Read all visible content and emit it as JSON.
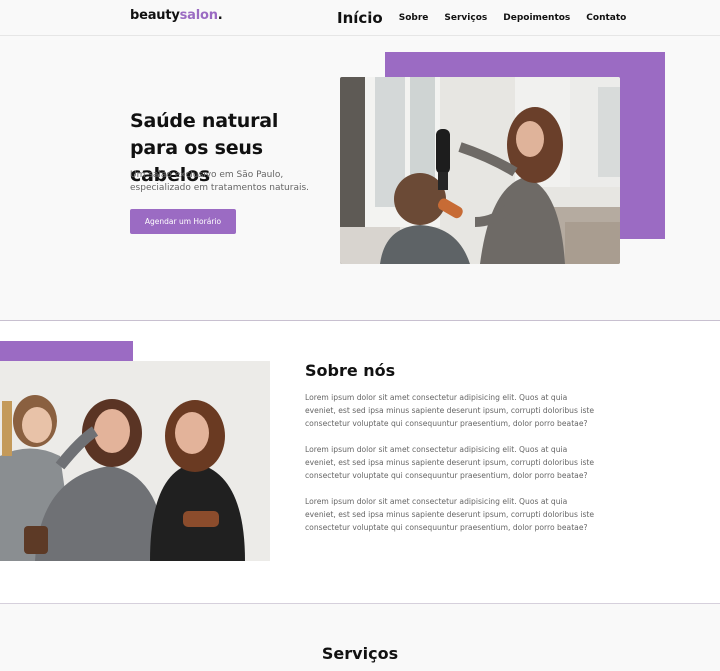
{
  "header": {
    "logo": {
      "part1": "beauty",
      "part2": "salon",
      "part3": "."
    },
    "nav": [
      {
        "label": "Início"
      },
      {
        "label": "Sobre"
      },
      {
        "label": "Serviços"
      },
      {
        "label": "Depoimentos"
      },
      {
        "label": "Contato"
      }
    ]
  },
  "hero": {
    "title": "Saúde natural para os seus cabelos",
    "subtitle": "Um salão exclusivo em São Paulo, especializado em tratamentos naturais.",
    "cta_label": "Agendar um Horário"
  },
  "about": {
    "title": "Sobre nós",
    "paragraphs": [
      "Lorem ipsum dolor sit amet consectetur adipisicing elit. Quos at quia eveniet, est sed ipsa minus sapiente deserunt ipsum, corrupti doloribus iste consectetur voluptate qui consequuntur praesentium, dolor porro beatae?",
      "Lorem ipsum dolor sit amet consectetur adipisicing elit. Quos at quia eveniet, est sed ipsa minus sapiente deserunt ipsum, corrupti doloribus iste consectetur voluptate qui consequuntur praesentium, dolor porro beatae?",
      "Lorem ipsum dolor sit amet consectetur adipisicing elit. Quos at quia eveniet, est sed ipsa minus sapiente deserunt ipsum, corrupti doloribus iste consectetur voluptate qui consequuntur praesentium, dolor porro beatae?"
    ]
  },
  "services": {
    "title": "Serviços"
  },
  "colors": {
    "accent": "#9b6bc3",
    "background": "#f9f9f9",
    "text": "#111111",
    "muted": "#666666"
  }
}
